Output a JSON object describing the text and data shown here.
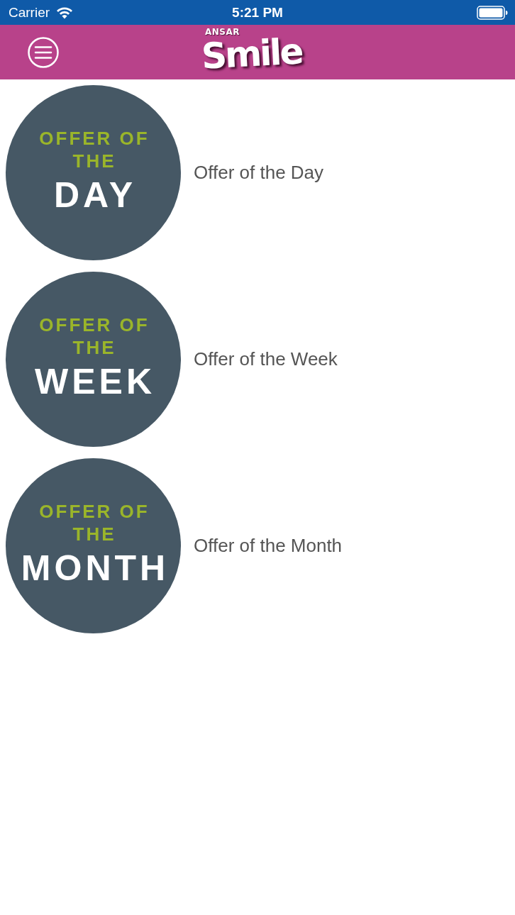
{
  "status_bar": {
    "carrier": "Carrier",
    "time": "5:21 PM"
  },
  "nav_bar": {
    "logo_small": "ANSAR",
    "logo_large": "Smile"
  },
  "offers": [
    {
      "badge_top": "OFFER OF",
      "badge_middle": "THE",
      "badge_bottom": "DAY",
      "label": "Offer of the Day"
    },
    {
      "badge_top": "OFFER OF",
      "badge_middle": "THE",
      "badge_bottom": "WEEK",
      "label": "Offer of the Week"
    },
    {
      "badge_top": "OFFER OF",
      "badge_middle": "THE",
      "badge_bottom": "MONTH",
      "label": "Offer of the Month"
    }
  ]
}
